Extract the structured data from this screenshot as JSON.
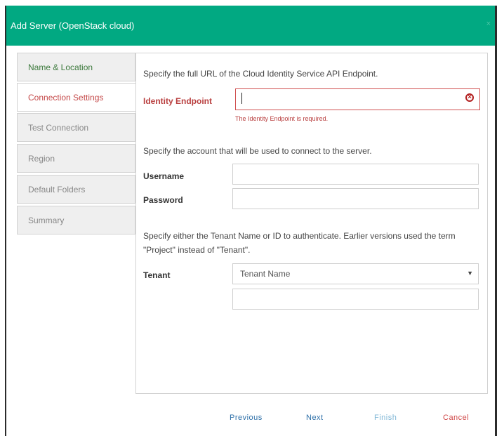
{
  "dialog": {
    "title": "Add Server (OpenStack cloud)",
    "close_glyph": "×"
  },
  "sidebar": {
    "items": [
      {
        "label": "Name & Location",
        "state": "done"
      },
      {
        "label": "Connection Settings",
        "state": "active"
      },
      {
        "label": "Test Connection",
        "state": "pending"
      },
      {
        "label": "Region",
        "state": "pending"
      },
      {
        "label": "Default Folders",
        "state": "pending"
      },
      {
        "label": "Summary",
        "state": "pending"
      }
    ]
  },
  "form": {
    "endpoint_instruction": "Specify the full URL of the Cloud Identity Service API Endpoint.",
    "identity_label": "Identity Endpoint",
    "identity_value": "",
    "identity_error": "The Identity Endpoint is required.",
    "account_instruction": "Specify the account that will be used to connect to the server.",
    "username_label": "Username",
    "username_value": "",
    "password_label": "Password",
    "password_value": "",
    "tenant_instruction_line1": "Specify either the Tenant Name or ID to authenticate. Earlier versions used the term",
    "tenant_instruction_line2": "\"Project\" instead of \"Tenant\".",
    "tenant_label": "Tenant",
    "tenant_type_selected": "Tenant Name",
    "tenant_value": ""
  },
  "footer": {
    "previous": "Previous",
    "next": "Next",
    "finish": "Finish",
    "cancel": "Cancel"
  },
  "colors": {
    "header": "#01a982",
    "error": "#b93f3f",
    "nav_link": "#2d6fa8",
    "finish_disabled": "#7fb6d6",
    "cancel": "#d04848"
  },
  "icons": {
    "clear": "circle-x-icon",
    "dropdown": "caret-down-icon"
  }
}
